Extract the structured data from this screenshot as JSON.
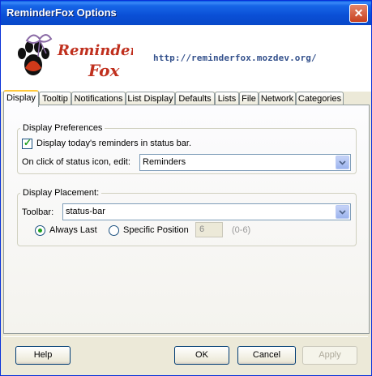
{
  "window": {
    "title": "ReminderFox Options"
  },
  "header": {
    "logo_text_top": "Reminder",
    "logo_text_bottom": "Fox",
    "url": "http://reminderfox.mozdev.org/"
  },
  "tabs": [
    "Display",
    "Tooltip",
    "Notifications",
    "List Display",
    "Defaults",
    "Lists",
    "File",
    "Network",
    "Categories"
  ],
  "display_preferences": {
    "legend": "Display Preferences",
    "checkbox_label": "Display today's reminders in status bar.",
    "checkbox_checked": true,
    "edit_label": "On click of status icon, edit:",
    "edit_value": "Reminders"
  },
  "display_placement": {
    "legend": "Display Placement:",
    "toolbar_label": "Toolbar:",
    "toolbar_value": "status-bar",
    "always_last_label": "Always Last",
    "specific_position_label": "Specific Position",
    "position_value": "6",
    "position_range": "(0-6)",
    "selected": "always_last"
  },
  "buttons": {
    "help": "Help",
    "ok": "OK",
    "cancel": "Cancel",
    "apply": "Apply"
  },
  "colors": {
    "titlebar": "#0a4fd6",
    "url": "#34518c",
    "check": "#21a121",
    "tab_highlight": "#ffc83c"
  }
}
